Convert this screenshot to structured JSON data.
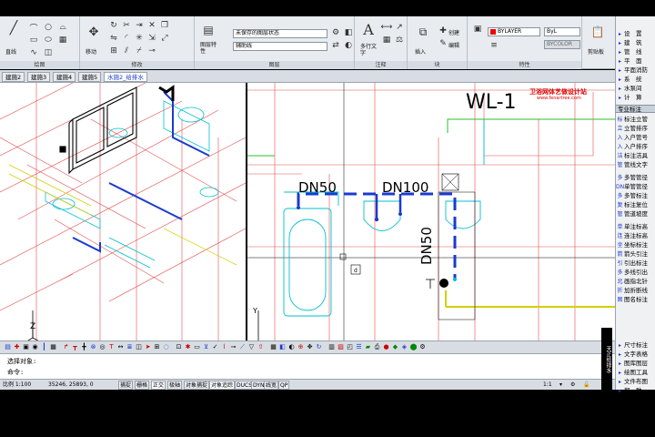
{
  "ribbon": {
    "panels": {
      "draw": "绘图",
      "modify": "修改",
      "layers": "图层",
      "annotation": "注释",
      "block": "块",
      "properties": "特性"
    },
    "tools": {
      "line": "直线",
      "move": "移动",
      "layer_props": "图层特性",
      "mtext": "多行文字",
      "insert": "插入",
      "create": "创建",
      "edit": "编辑",
      "clipboard": "剪贴板"
    },
    "layer_state": "未保存的图层状态",
    "layer_current": "辅助线",
    "color": "BYLAYER",
    "lineweight": "ByL",
    "plotstyle": "BYCOLOR"
  },
  "tabs": [
    {
      "label": "建施2",
      "active": false
    },
    {
      "label": "建施3",
      "active": false
    },
    {
      "label": "建施4",
      "active": false
    },
    {
      "label": "建施5",
      "active": false
    },
    {
      "label": "水施2_给排水",
      "active": true
    }
  ],
  "drawing": {
    "wl_label": "WL-1",
    "watermark": "卫浴网体艺做设计站",
    "watermark_url": "www.fenartree.com",
    "dn50_top": "DN50",
    "dn100": "DN100",
    "dn50_vertical": "DN50",
    "ucs_x": "X",
    "ucs_y": "Y",
    "ucs_z": "Z",
    "marker": "d"
  },
  "command": {
    "line1": "选择对象:",
    "line2": "命令:"
  },
  "status": {
    "scale": "比例 1:100",
    "coords": "35246, 25893, 0",
    "buttons": [
      "捕捉",
      "栅格",
      "正交",
      "极轴",
      "对象捕捉",
      "对象追踪",
      "DUCS",
      "DYN",
      "线宽",
      "QP"
    ],
    "zoom": "1:1"
  },
  "right_panel": {
    "top_items": [
      "设　置",
      "建　筑",
      "管　线",
      "平　面",
      "平面消防",
      "系　统",
      "水泵间",
      "计　算"
    ],
    "section_label": "专业标注",
    "items": [
      {
        "icon": "标",
        "label": "标注立管"
      },
      {
        "icon": "立",
        "label": "立管排序"
      },
      {
        "icon": "入",
        "label": "入户管号"
      },
      {
        "icon": "入",
        "label": "入户排序"
      },
      {
        "icon": "洁",
        "label": "标注洁具"
      },
      {
        "icon": "管",
        "label": "管线文字"
      },
      {
        "icon": "多",
        "label": "多管管径"
      },
      {
        "icon": "DN",
        "label": "单管管径"
      },
      {
        "icon": "多",
        "label": "多管标注"
      },
      {
        "icon": "复",
        "label": "标注复位"
      },
      {
        "icon": "管",
        "label": "管道坡度"
      },
      {
        "icon": "单",
        "label": "单注标高"
      },
      {
        "icon": "连",
        "label": "连注标高"
      },
      {
        "icon": "坐",
        "label": "坐标标注"
      },
      {
        "icon": "箭",
        "label": "箭头引注"
      },
      {
        "icon": "引",
        "label": "引出标注"
      },
      {
        "icon": "多",
        "label": "多线引出"
      },
      {
        "icon": "北",
        "label": "画指北针"
      },
      {
        "icon": "折",
        "label": "加折断线"
      },
      {
        "icon": "图",
        "label": "图名标注"
      }
    ],
    "bottom_items": [
      "尺寸标注",
      "文字表格",
      "图库图层",
      "绘图工具",
      "文件布图",
      "帮　助"
    ],
    "side_label": "天正给排水"
  }
}
